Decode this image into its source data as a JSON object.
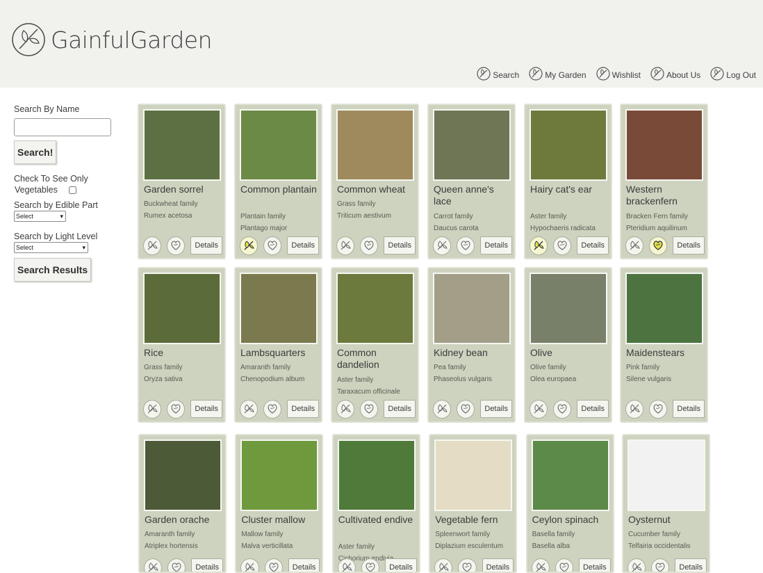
{
  "brand": {
    "name": "GainfulGarden"
  },
  "nav": [
    {
      "label": "Search",
      "icon": "search-leaf-icon"
    },
    {
      "label": "My Garden",
      "icon": "leaf-icon"
    },
    {
      "label": "Wishlist",
      "icon": "heart-leaf-icon"
    },
    {
      "label": "About Us",
      "icon": "people-leaf-icon"
    },
    {
      "label": "Log Out",
      "icon": "door-leaf-icon"
    }
  ],
  "sidebar": {
    "search_label": "Search By Name",
    "search_value": "",
    "search_button": "Search!",
    "veg_label_1": "Check To See Only",
    "veg_label_2": "Vegetables",
    "edible_label": "Search by Edible Part",
    "edible_selected": "Select",
    "light_label": "Search by Light Level",
    "light_selected": "Select",
    "results_button": "Search Results"
  },
  "plants": [
    {
      "name": "Garden sorrel",
      "family": "Buckwheat family",
      "sci": "Rumex acetosa",
      "garden": false,
      "wish": false,
      "color": "#5d7043"
    },
    {
      "name": "Common plantain",
      "family": "Plantain family",
      "sci": "Plantago major",
      "garden": true,
      "wish": false,
      "color": "#6b8a45"
    },
    {
      "name": "Common wheat",
      "family": "Grass family",
      "sci": "Triticum aestivum",
      "garden": false,
      "wish": false,
      "color": "#9e8a5c"
    },
    {
      "name": "Queen anne's lace",
      "family": "Carrot family",
      "sci": "Daucus carota",
      "garden": false,
      "wish": false,
      "color": "#6f7656"
    },
    {
      "name": "Hairy cat's ear",
      "family": "Aster family",
      "sci": "Hypochaeris radicata",
      "garden": true,
      "wish": false,
      "color": "#6d7a3c"
    },
    {
      "name": "Western brackenfern",
      "family": "Bracken Fern family",
      "sci": "Pteridium aquilinum",
      "garden": false,
      "wish": true,
      "color": "#7a4a38"
    },
    {
      "name": "Rice",
      "family": "Grass family",
      "sci": "Oryza sativa",
      "garden": false,
      "wish": false,
      "color": "#5c6b3a"
    },
    {
      "name": "Lambsquarters",
      "family": "Amaranth family",
      "sci": "Chenopodium album",
      "garden": false,
      "wish": false,
      "color": "#7a7a4e"
    },
    {
      "name": "Common dandelion",
      "family": "Aster family",
      "sci": "Taraxacum officinale",
      "garden": false,
      "wish": false,
      "color": "#6c7a3d"
    },
    {
      "name": "Kidney bean",
      "family": "Pea family",
      "sci": "Phaseolus vulgaris",
      "garden": false,
      "wish": false,
      "color": "#a39e88"
    },
    {
      "name": "Olive",
      "family": "Olive family",
      "sci": "Olea europaea",
      "garden": false,
      "wish": false,
      "color": "#78806a"
    },
    {
      "name": "Maidenstears",
      "family": "Pink family",
      "sci": "Silene vulgaris",
      "garden": false,
      "wish": false,
      "color": "#4d7440"
    },
    {
      "name": "Garden orache",
      "family": "Amaranth family",
      "sci": "Atriplex hortensis",
      "garden": false,
      "wish": false,
      "color": "#4d5a38"
    },
    {
      "name": "Cluster mallow",
      "family": "Mallow family",
      "sci": "Malva verticillata",
      "garden": false,
      "wish": false,
      "color": "#6e9a3d"
    },
    {
      "name": "Cultivated endive",
      "family": "Aster family",
      "sci": "Cichorium endivia",
      "garden": false,
      "wish": false,
      "color": "#4f7a3a"
    },
    {
      "name": "Vegetable fern",
      "family": "Spleenwort family",
      "sci": "Diplazium esculentum",
      "garden": false,
      "wish": false,
      "color": "#e4dcc4"
    },
    {
      "name": "Ceylon spinach",
      "family": "Basella family",
      "sci": "Basella alba",
      "garden": false,
      "wish": false,
      "color": "#5c8a48"
    },
    {
      "name": "Oysternut",
      "family": "Cucumber family",
      "sci": "Telfairia occidentalis",
      "garden": false,
      "wish": false,
      "color": "#f2f2f2"
    }
  ],
  "details_label": "Details"
}
